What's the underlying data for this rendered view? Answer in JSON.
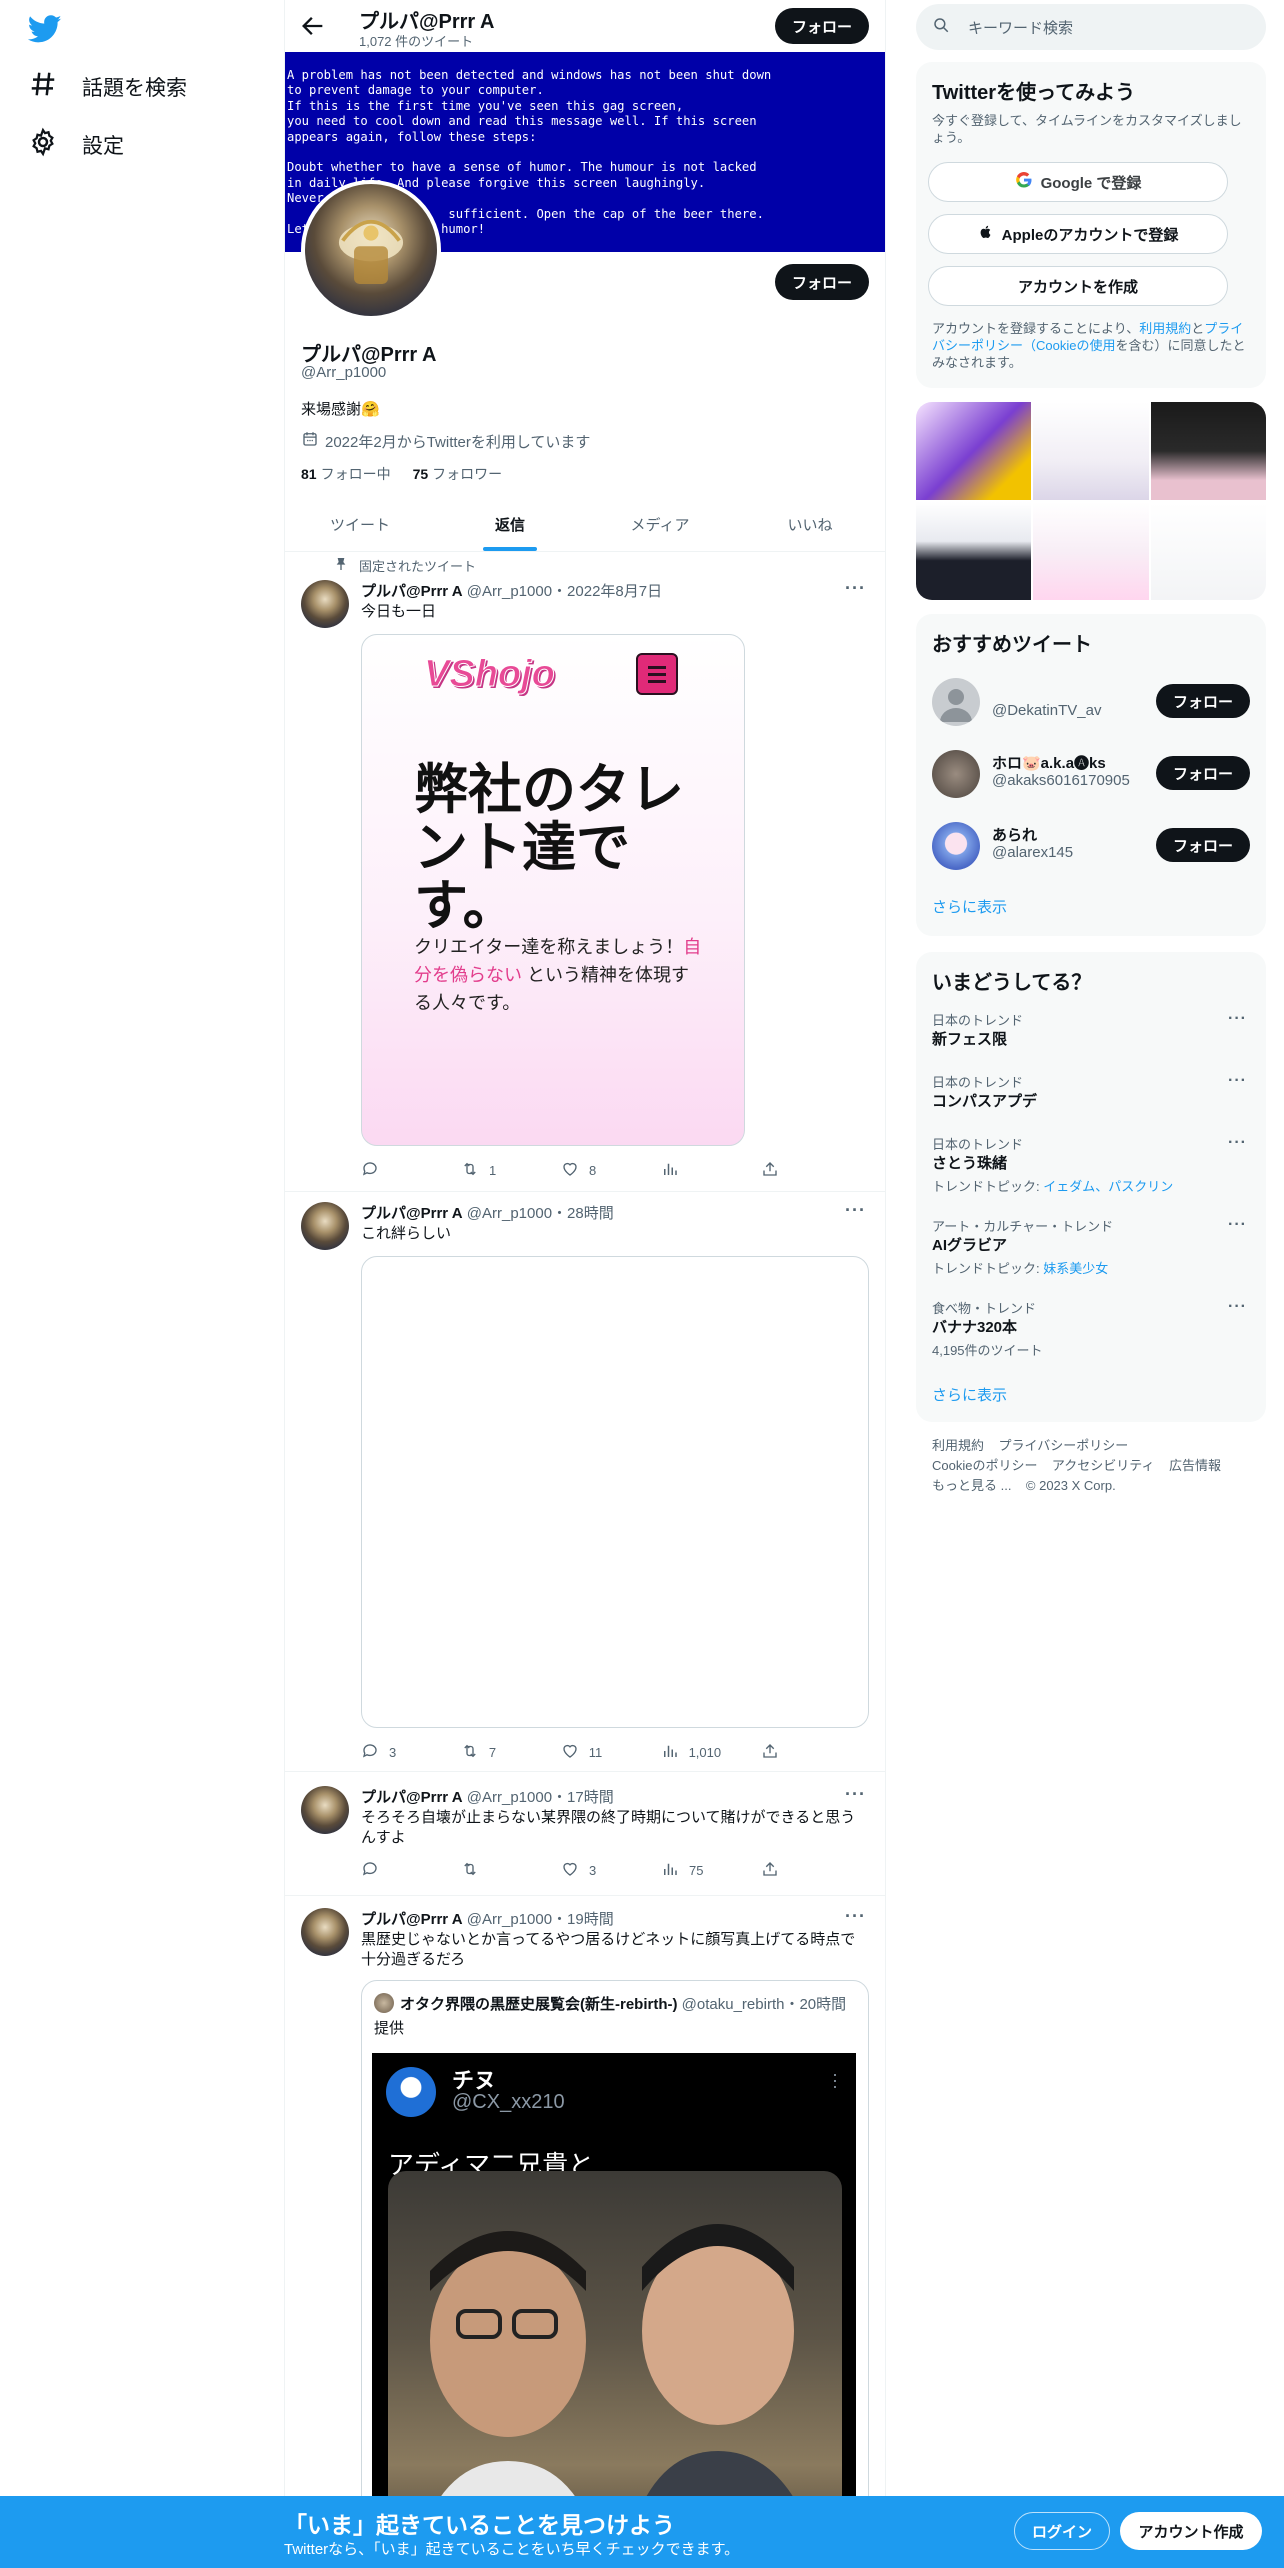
{
  "nav": {
    "explore_label": "話題を検索",
    "settings_label": "設定"
  },
  "profile": {
    "top_name": "プルパ@Prrr A",
    "tweet_count": "1,072 件のツイート",
    "follow_label": "フォロー",
    "banner_text": "A problem has not been detected and windows has not been shut down\nto prevent damage to your computer.\nIf this is the first time you've seen this gag screen,\nyou need to cool down and read this message well. If this screen\nappears again, follow these steps:\n\nDoubt whether to have a sense of humor. The humour is not lacked\nin daily life. And please forgive this screen laughingly.\nNever on\n                      sufficient. Open the cap of the beer there.\nLet's                humor!",
    "name": "プルパ@Prrr A",
    "handle": "@Arr_p1000",
    "bio": "来場感謝🤗",
    "joined": "2022年2月からTwitterを利用しています",
    "following_count": "81",
    "following_label": "フォロー中",
    "followers_count": "75",
    "followers_label": "フォロワー"
  },
  "tabs": [
    {
      "label": "ツイート"
    },
    {
      "label": "返信"
    },
    {
      "label": "メディア"
    },
    {
      "label": "いいね"
    }
  ],
  "tweets": [
    {
      "pinned_label": "固定されたツイート",
      "name": "プルパ@Prrr A",
      "meta": "@Arr_p1000・2022年8月7日",
      "text": "今日も一日",
      "card": {
        "logo": "VShojo",
        "headline": "弊社のタレント達です。",
        "sub_before": "クリエイター達を称えましょう！",
        "sub_highlight": "自分を偽らない",
        "sub_after": " という精神を体現する人々です。"
      },
      "replies": "",
      "retweets": "1",
      "likes": "8",
      "views": ""
    },
    {
      "name": "プルパ@Prrr A",
      "meta": "@Arr_p1000・28時間",
      "text": "これ絆らしい",
      "replies": "3",
      "retweets": "7",
      "likes": "11",
      "views": "1,010"
    },
    {
      "name": "プルパ@Prrr A",
      "meta": "@Arr_p1000・17時間",
      "text": "そろそろ自壊が止まらない某界隈の終了時期について賭けができると思うんすよ",
      "replies": "",
      "retweets": "",
      "likes": "3",
      "views": "75"
    },
    {
      "name": "プルパ@Prrr A",
      "meta": "@Arr_p1000・19時間",
      "text": "黒歴史じゃないとか言ってるやつ居るけどネットに顔写真上げてる時点で十分過ぎるだろ",
      "quote": {
        "name": "オタク界隈の黒歴史展覧会(新生-rebirth-)",
        "meta": "@otaku_rebirth・20時間",
        "text": "提供",
        "img_name": "チヌ",
        "img_handle": "@CX_xx210",
        "img_text": "アディマ二兄貴と"
      }
    }
  ],
  "right": {
    "search_placeholder": "キーワード検索",
    "signup_title": "Twitterを使ってみよう",
    "signup_sub": "今すぐ登録して、タイムラインをカスタマイズしましょう。",
    "google_label": "Google で登録",
    "apple_label": "Appleのアカウントで登録",
    "create_label": "アカウントを作成",
    "legal_before": "アカウントを登録することにより、",
    "legal_terms": "利用規約",
    "legal_mid": "と",
    "legal_privacy": "プライバシーポリシー",
    "legal_cookie": "（Cookieの使用",
    "legal_after": "を含む）に同意したとみなされます。",
    "reco_title": "おすすめツイート",
    "reco": [
      {
        "name": "",
        "handle": "@DekatinTV_av",
        "button": "フォロー"
      },
      {
        "name": "ホロ🐷a.k.a🅐ks",
        "handle": "@akaks6016170905",
        "button": "フォロー"
      },
      {
        "name": "あられ",
        "handle": "@alarex145",
        "button": "フォロー"
      }
    ],
    "show_more": "さらに表示",
    "trends_title": "いまどうしてる？",
    "trends": [
      {
        "category": "日本のトレンド",
        "name": "新フェス限",
        "sub_label": "",
        "sub_link": ""
      },
      {
        "category": "日本のトレンド",
        "name": "コンパスアプデ",
        "sub_label": "",
        "sub_link": ""
      },
      {
        "category": "日本のトレンド",
        "name": "さとう珠緒",
        "sub_label": "トレンドトピック: ",
        "sub_link": "イェダム、パスクリン"
      },
      {
        "category": "アート・カルチャー・トレンド",
        "name": "AIグラビア",
        "sub_label": "トレンドトピック: ",
        "sub_link": "妹系美少女"
      },
      {
        "category": "食べ物・トレンド",
        "name": "バナナ320本",
        "sub_label": "4,195件のツイート",
        "sub_link": ""
      }
    ],
    "footer": {
      "terms": "利用規約",
      "privacy": "プライバシーポリシー",
      "cookie": "Cookieのポリシー",
      "accessibility": "アクセシビリティ",
      "ads": "広告情報",
      "more": "もっと見る ...",
      "copyright": "© 2023 X Corp."
    }
  },
  "bottombar": {
    "title": "「いま」起きていることを見つけよう",
    "sub": "Twitterなら、「いま」起きていることをいち早くチェックできます。",
    "login": "ログイン",
    "signup": "アカウント作成"
  },
  "colors": {
    "accent": "#1d9bf0",
    "text": "#0f1419",
    "muted": "#536471",
    "banner_bg": "#0000a8"
  }
}
